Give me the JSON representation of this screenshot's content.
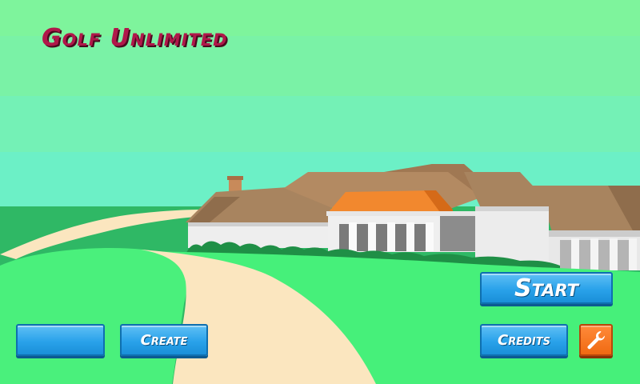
{
  "game": {
    "title": "Golf Unlimited"
  },
  "menu": {
    "start_label": "Start",
    "blank_label": "",
    "create_label": "Create",
    "credits_label": "Credits",
    "settings_icon": "wrench-icon"
  },
  "colors": {
    "title": "#b0184a",
    "button_blue": "#2aa2ea",
    "button_orange": "#f06a12",
    "sky_top": "#7ef0a0",
    "grass": "#46f07e",
    "path": "#fbe6bf",
    "roof": "#a8845f",
    "orange_roof": "#f2882e"
  }
}
